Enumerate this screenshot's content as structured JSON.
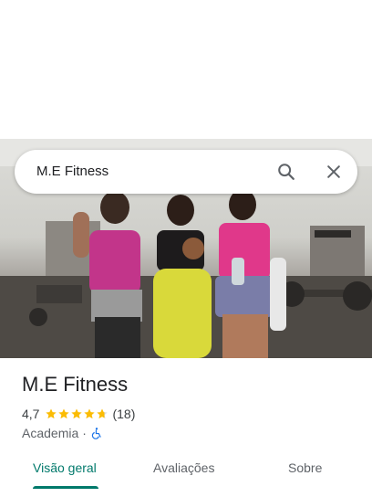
{
  "search": {
    "query": "M.E Fitness"
  },
  "icons": {
    "search": "search-icon",
    "close": "close-icon",
    "star": "star-icon",
    "accessibility": "wheelchair-icon"
  },
  "place": {
    "name": "M.E Fitness",
    "rating": "4,7",
    "rating_value": 4.7,
    "review_count": "(18)",
    "category": "Academia",
    "separator": "·"
  },
  "tabs": [
    {
      "label": "Visão geral",
      "active": true
    },
    {
      "label": "Avaliações",
      "active": false
    },
    {
      "label": "Sobre",
      "active": false
    }
  ],
  "colors": {
    "accent": "#00796b",
    "star": "#fbbc04",
    "accessibility": "#1a73e8"
  }
}
